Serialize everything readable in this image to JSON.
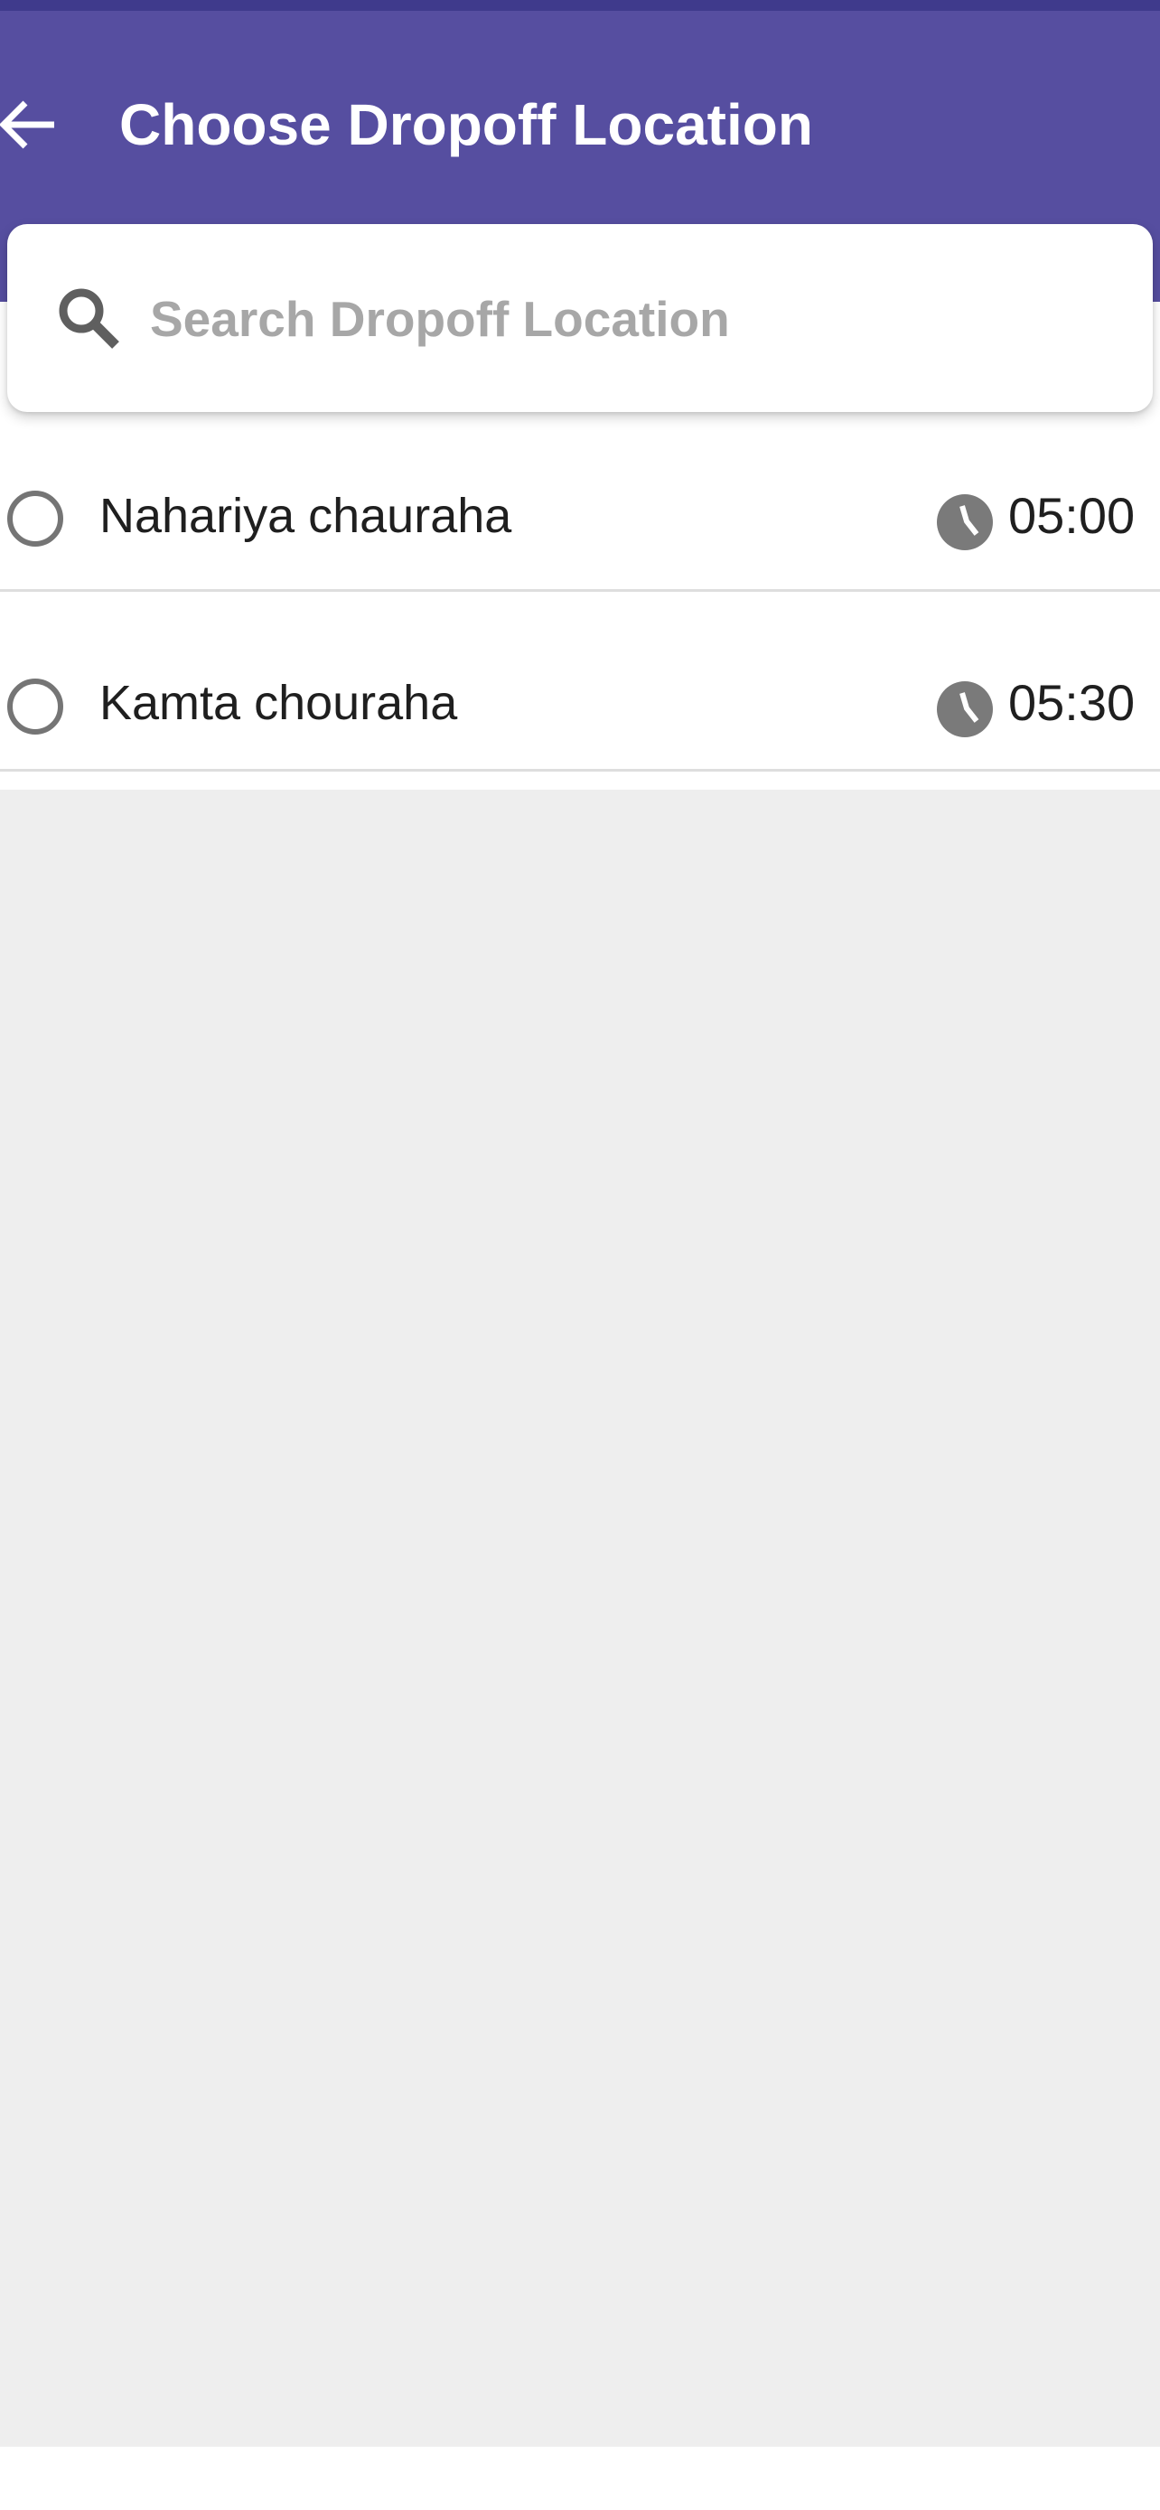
{
  "header": {
    "title": "Choose Dropoff Location",
    "back_icon": "arrow-left-icon"
  },
  "search": {
    "placeholder": "Search Dropoff Location",
    "value": "",
    "icon": "search-icon"
  },
  "locations": [
    {
      "name": "Nahariya chauraha",
      "time": "05:00",
      "selected": false
    },
    {
      "name": "Kamta chouraha",
      "time": "05:30",
      "selected": false
    }
  ],
  "colors": {
    "app_bar": "#564ea0",
    "status_strip": "#3f3a8c",
    "background": "#eeeeee",
    "radio": "#757575",
    "clock": "#7a7a7a",
    "placeholder": "#a7a7a7",
    "text": "#1f1f1f"
  }
}
